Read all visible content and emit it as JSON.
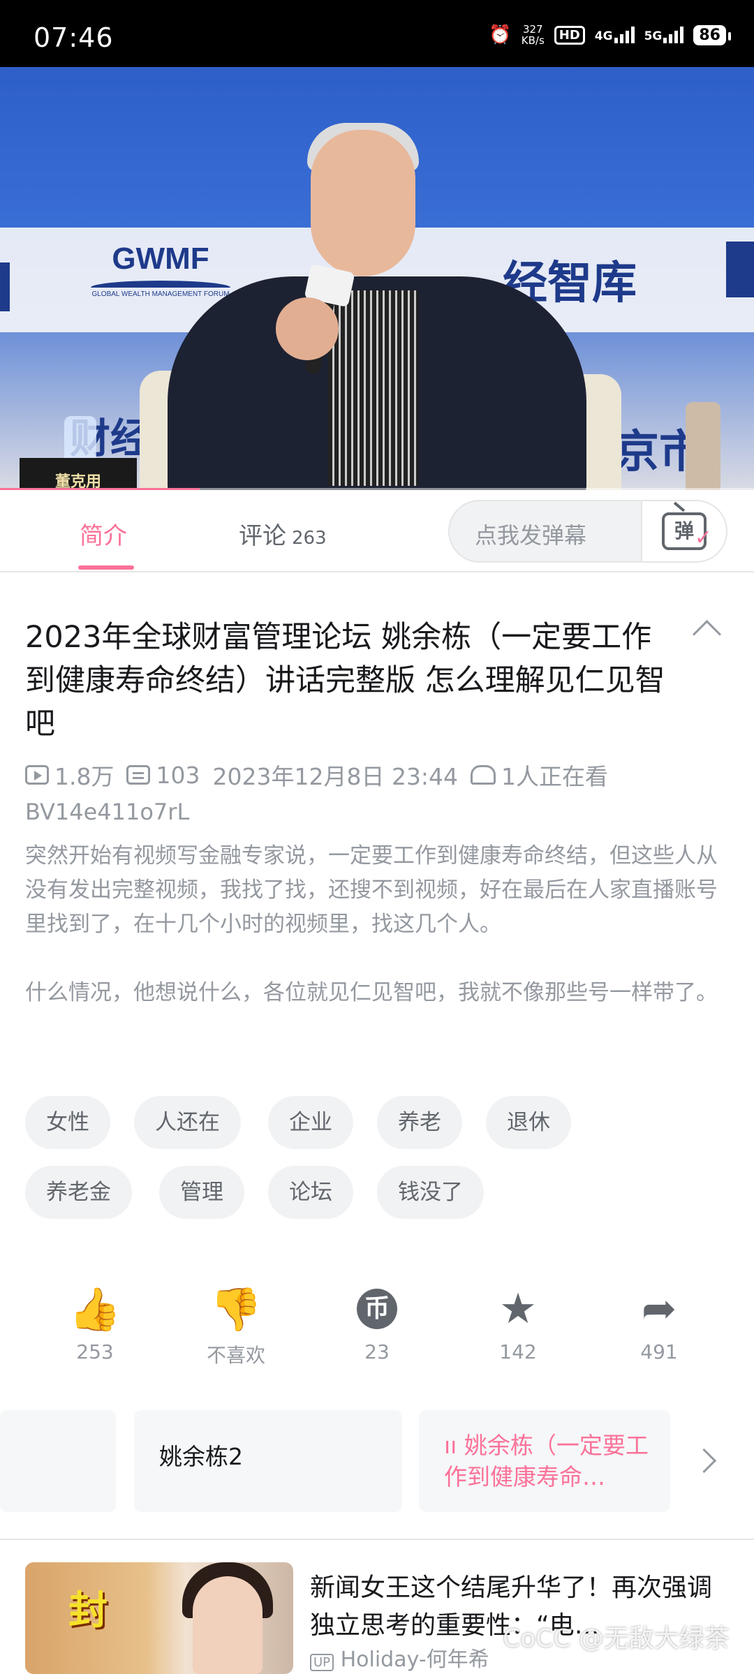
{
  "status_bar": {
    "time": "07:46",
    "speed_value": "327",
    "speed_unit": "KB/s",
    "hd_badge": "HD",
    "net_4g": "4G",
    "net_5g": "5G",
    "battery": "86"
  },
  "video": {
    "nameplate": "董克用",
    "logo_gwmf": "GWMF",
    "logo_gwmf_sub": "GLOBAL WEALTH MANAGEMENT FORUM",
    "logo_zhiku": "经智库",
    "backdrop_text": "京市",
    "backdrop_text2": "财经",
    "progress": 0.265
  },
  "tabs": {
    "intro": "简介",
    "comments": "评论",
    "comments_count": "263",
    "danmaku_placeholder": "点我发弹幕",
    "danmaku_icon_char": "弹"
  },
  "detail": {
    "title": "2023年全球财富管理论坛 姚余栋（一定要工作到健康寿命终结）讲话完整版 怎么理解见仁见智吧",
    "views": "1.8万",
    "danmaku_count": "103",
    "datetime": "2023年12月8日 23:44",
    "watching": "1人正在看",
    "bvid": "BV14e411o7rL",
    "description": "突然开始有视频写金融专家说，一定要工作到健康寿命终结，但这些人从没有发出完整视频，我找了找，还搜不到视频，好在最后在人家直播账号里找到了，在十几个小时的视频里，找这几个人。\n\n什么情况，他想说什么，各位就见仁见智吧，我就不像那些号一样带了。",
    "tags": [
      "女性",
      "人还在",
      "企业",
      "养老",
      "退休",
      "养老金",
      "管理",
      "论坛",
      "钱没了"
    ]
  },
  "actions": {
    "like": "253",
    "dislike": "不喜欢",
    "coin": "23",
    "coin_icon": "币",
    "favorite": "142",
    "share": "491"
  },
  "episodes": {
    "ep2": "姚余栋2",
    "current_prefix": "ıı",
    "current": "姚余栋（一定要工作到健康寿命…"
  },
  "recommendation": {
    "thumb_text": "封",
    "title": "新闻女王这个结尾升华了！再次强调独立思考的重要性：“电…",
    "up_label": "UP",
    "uploader": "Holiday-何年希"
  },
  "watermark": "CoCC @无敌大绿茶",
  "colors": {
    "accent": "#fb7299",
    "text_secondary": "#9499a0"
  }
}
